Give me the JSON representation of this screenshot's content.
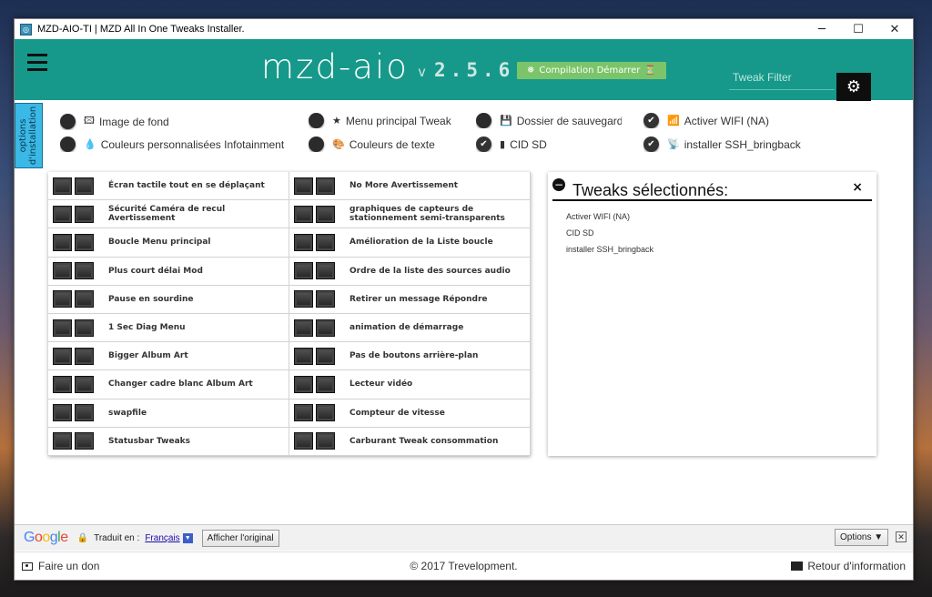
{
  "window": {
    "title": "MZD-AIO-TI | MZD All In One Tweaks Installer.",
    "minimize_glyph": "─",
    "maximize_glyph": "☐",
    "close_glyph": "✕"
  },
  "header": {
    "brand": "mzd-aio",
    "version_prefix": "v",
    "version": "2.5.6",
    "compile_button": "Compilation Démarrer",
    "tweak_filter_placeholder": "Tweak Filter",
    "accent_color": "#16998a"
  },
  "side_tab": {
    "label_line1": "options",
    "label_line2": "d'installation"
  },
  "options": [
    {
      "label": "Image de fond",
      "icon": "image-icon",
      "glyph": "🖾",
      "checked": false
    },
    {
      "label": "Couleurs personnalisées Infotainment",
      "icon": "drop-icon",
      "glyph": "💧",
      "checked": false
    },
    {
      "label": "Menu principal Tweak",
      "icon": "star-icon",
      "glyph": "★",
      "checked": false
    },
    {
      "label": "Couleurs de texte",
      "icon": "palette-icon",
      "glyph": "🎨",
      "checked": false
    },
    {
      "label": "Dossier de sauvegarde",
      "icon": "save-icon",
      "glyph": "💾",
      "checked": false
    },
    {
      "label": "CID SD",
      "icon": "sd-card-icon",
      "glyph": "▮",
      "checked": true
    },
    {
      "label": "Activer WIFI (NA)",
      "icon": "wifi-icon",
      "glyph": "📶",
      "checked": true
    },
    {
      "label": "installer SSH_bringback",
      "icon": "broadcast-icon",
      "glyph": "📡",
      "checked": true
    }
  ],
  "tweaks_left": [
    "Écran tactile tout en se déplaçant",
    "Sécurité Caméra de recul Avertissement",
    "Boucle Menu principal",
    "Plus court délai Mod",
    "Pause en sourdine",
    "1 Sec Diag Menu",
    "Bigger Album Art",
    "Changer cadre blanc Album Art",
    "swapfile",
    "Statusbar Tweaks"
  ],
  "tweaks_right": [
    "No More Avertissement",
    "graphiques de capteurs de stationnement semi-transparents",
    "Amélioration de la Liste boucle",
    "Ordre de la liste des sources audio",
    "Retirer un message Répondre",
    "animation de démarrage",
    "Pas de boutons arrière-plan",
    "Lecteur vidéo",
    "Compteur de vitesse",
    "Carburant Tweak consommation"
  ],
  "selected_panel": {
    "title": "Tweaks sélectionnés:",
    "close_glyph": "×",
    "items": [
      "Activer WIFI (NA)",
      "CID SD",
      "installer SSH_bringback"
    ]
  },
  "translate_bar": {
    "logo": "Google",
    "translated_label": "Traduit en :",
    "language": "Français",
    "show_original": "Afficher l'original",
    "options": "Options ▼",
    "close_glyph": "✕"
  },
  "footer": {
    "donate": "Faire un don",
    "copyright": "© 2017 Trevelopment.",
    "feedback": "Retour d'information"
  }
}
